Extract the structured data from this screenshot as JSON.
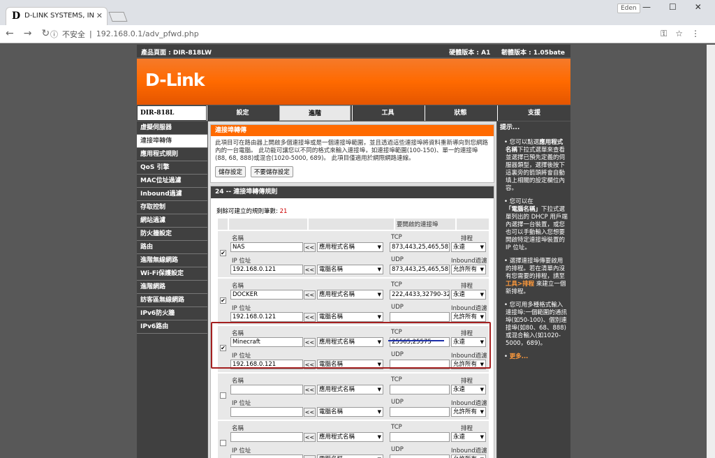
{
  "browser": {
    "tab_title": "D-LINK SYSTEMS, INC. |",
    "user": "Eden",
    "insecure": "不安全",
    "url": "192.168.0.1/adv_pfwd.php"
  },
  "header": {
    "product": "產品頁面 : DIR-818LW",
    "hw": "硬體版本 : A1",
    "fw": "韌體版本 : 1.05bate"
  },
  "logo": "D-Link",
  "model": "DIR-818L",
  "menu": [
    "設定",
    "進階",
    "工具",
    "狀態",
    "支援"
  ],
  "sidebar": [
    "虛擬伺服器",
    "連接埠轉傳",
    "應用程式規則",
    "QoS 引擎",
    "MAC位址過濾",
    "Inbound過濾",
    "存取控制",
    "網站過濾",
    "防火牆設定",
    "路由",
    "進階無線網路",
    "Wi-Fi保護設定",
    "進階網路",
    "訪客區無線網路",
    "IPv6防火牆",
    "IPv6路由"
  ],
  "section1": {
    "title": "連接埠轉傳",
    "desc": "此項目可在路由器上開啟多個連接埠或是一個連接埠範圍，並且透過這些連接埠將資料重新導向到您網路內的一台電腦。 此功能可讓您以不同的格式來輸入連接埠，如連接埠範圍(100-150)、單一的連接埠(88, 68, 888)或混合(1020-5000, 689)。 此項目僅適用於網際網路連線。",
    "save": "儲存設定",
    "nosave": "不要儲存設定"
  },
  "section2": {
    "title": "24 -- 連接埠轉傳規則",
    "remain_label": "剩餘可建立的規則筆數: ",
    "remain": "21",
    "col_ports": "要開啟的連接埠"
  },
  "labels": {
    "name": "名稱",
    "ip": "IP 位址",
    "tcp": "TCP",
    "udp": "UDP",
    "schedule": "排程",
    "inbound": "Inbound過濾",
    "app": "應用程式名稱",
    "pc": "電腦名稱",
    "ll": "<<"
  },
  "rules": [
    {
      "checked": "✔",
      "name": "NAS",
      "ip": "192.168.0.121",
      "tcp": "873,443,25,465,587,1",
      "udp": "873,443,25,465,587,1",
      "schedule": "永遠",
      "inbound": "允許所有"
    },
    {
      "checked": "✔",
      "name": "DOCKER",
      "ip": "192.168.0.121",
      "tcp": "222,4433,32790-3279",
      "udp": "",
      "schedule": "永遠",
      "inbound": "允許所有"
    },
    {
      "checked": "✔",
      "name": "Minecraft",
      "ip": "192.168.0.121",
      "tcp": "25565,25575",
      "udp": "",
      "schedule": "永遠",
      "inbound": "允許所有"
    },
    {
      "checked": "",
      "name": "",
      "ip": "",
      "tcp": "",
      "udp": "",
      "schedule": "永遠",
      "inbound": "允許所有"
    },
    {
      "checked": "",
      "name": "",
      "ip": "",
      "tcp": "",
      "udp": "",
      "schedule": "永遠",
      "inbound": "允許所有"
    }
  ],
  "help": {
    "title": "提示...",
    "p1a": "您可以點選",
    "p1b": "應用程式名稱",
    "p1c": "下拉式選單來查看並選擇已預先定義的伺服器類型，選擇後按下這裏旁的箭頭將會自動填上相關的設定欄位內容。",
    "p2a": "您可以在",
    "p2b": "「電腦名稱」",
    "p2c": "下拉式選單列出的 DHCP 用戶端內選擇一台裝置，或您也可以手動輸入您想要開啟特定連接埠裝置的 IP 位址。",
    "p3a": "選擇連接埠傳要啟用的排程。若在清單內沒有您需要的排程，請至 ",
    "p3b": "工具>排程",
    "p3c": " 來建立一個新排程。",
    "p4": "您可用多種格式輸入連接埠:一個範圍的通訊埠(如50-100)、個別連接埠(如80、68、888) 或混合輸入(如1020-5000，689)。",
    "more": "更多..."
  }
}
